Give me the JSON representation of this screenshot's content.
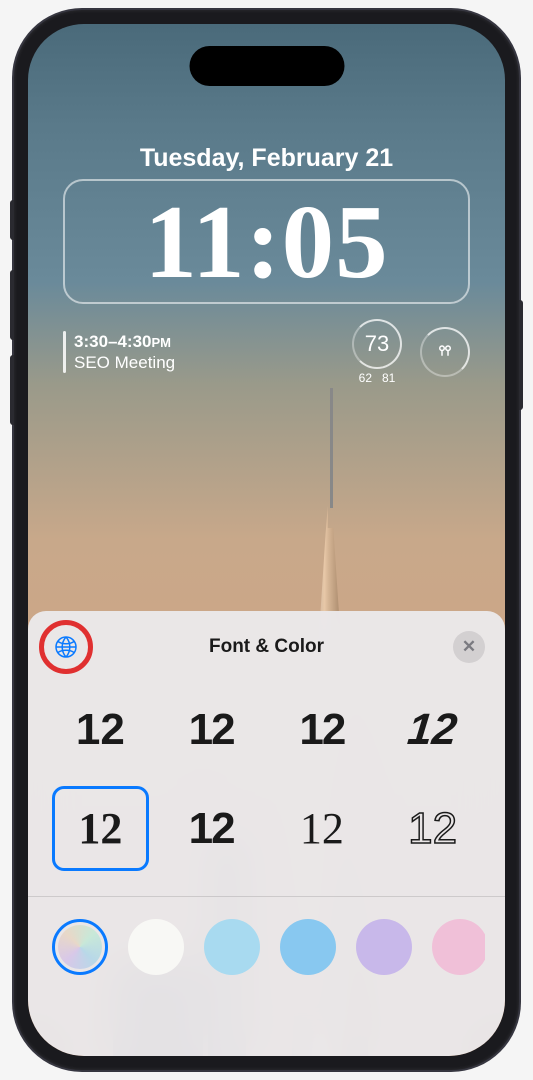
{
  "date": "Tuesday, February 21",
  "time": "11:05",
  "widgets": {
    "event": {
      "time": "3:30–4:30",
      "time_suffix": "PM",
      "title": "SEO Meeting"
    },
    "temp": {
      "current": "73",
      "low": "62",
      "high": "81"
    }
  },
  "panel": {
    "title": "Font & Color",
    "fonts": [
      {
        "label": "12",
        "class": "f1",
        "selected": false
      },
      {
        "label": "12",
        "class": "f2",
        "selected": false
      },
      {
        "label": "12",
        "class": "f3",
        "selected": false
      },
      {
        "label": "12",
        "class": "f4",
        "selected": false
      },
      {
        "label": "12",
        "class": "f5",
        "selected": true
      },
      {
        "label": "12",
        "class": "f6",
        "selected": false
      },
      {
        "label": "12",
        "class": "f7",
        "selected": false
      },
      {
        "label": "12",
        "class": "f8",
        "selected": false
      }
    ],
    "colors": [
      "c1",
      "c2",
      "c3",
      "c4",
      "c5",
      "c6"
    ],
    "close_label": "✕"
  },
  "annotation": {
    "highlight": "globe-button"
  }
}
